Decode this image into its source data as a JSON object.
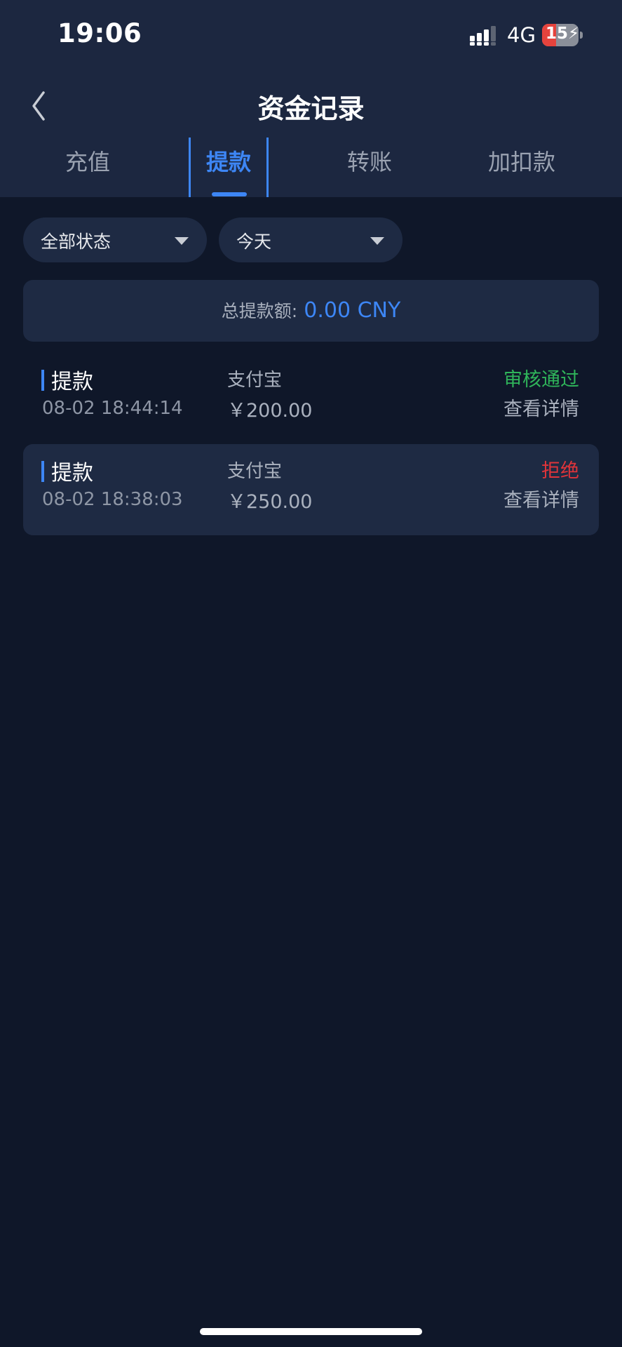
{
  "status_bar": {
    "time": "19:06",
    "network": "4G",
    "battery": "15",
    "battery_level": 0.15
  },
  "nav": {
    "title": "资金记录",
    "back_icon": "chevron-left-icon"
  },
  "tabs": [
    {
      "label": "充值",
      "active": false
    },
    {
      "label": "提款",
      "active": true
    },
    {
      "label": "转账",
      "active": false
    },
    {
      "label": "加扣款",
      "active": false
    }
  ],
  "filters": {
    "status": "全部状态",
    "date": "今天",
    "caret_icon": "caret-down-icon"
  },
  "summary": {
    "label": "总提款额:",
    "value": "0.00 CNY"
  },
  "records": [
    {
      "type": "提款",
      "time": "08-02 18:44:14",
      "method": "支付宝",
      "amount": "￥200.00",
      "status": "审核通过",
      "status_color": "#2fb45a",
      "detail": "查看详情"
    },
    {
      "type": "提款",
      "time": "08-02 18:38:03",
      "method": "支付宝",
      "amount": "￥250.00",
      "status": "拒绝",
      "status_color": "#e0343a",
      "detail": "查看详情"
    }
  ],
  "colors": {
    "accent": "#3d86f5",
    "background": "#0f1729",
    "header": "#1c2740",
    "card": "#1e2a43"
  }
}
